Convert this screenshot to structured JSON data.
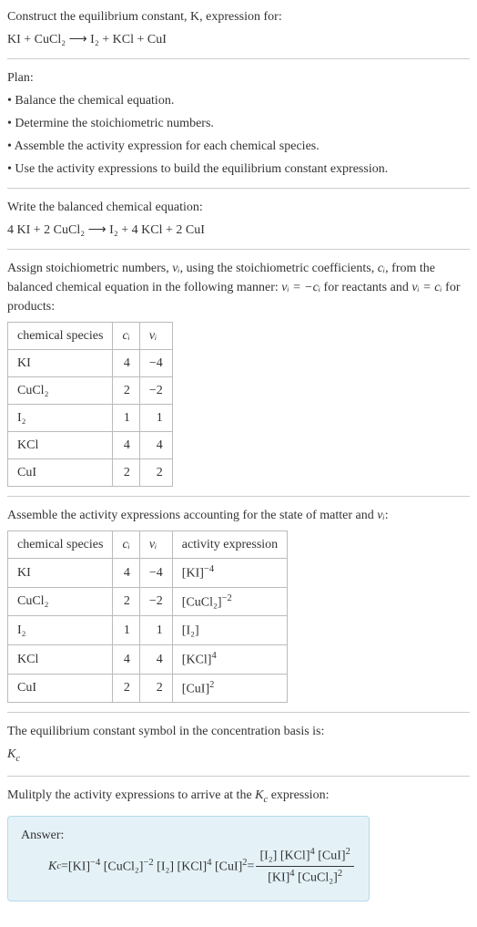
{
  "intro": {
    "header": "Construct the equilibrium constant, K, expression for:",
    "equation": "KI + CuCl₂ ⟶ I₂ + KCl + CuI"
  },
  "plan": {
    "title": "Plan:",
    "items": [
      "• Balance the chemical equation.",
      "• Determine the stoichiometric numbers.",
      "• Assemble the activity expression for each chemical species.",
      "• Use the activity expressions to build the equilibrium constant expression."
    ]
  },
  "balanced": {
    "label": "Write the balanced chemical equation:",
    "equation": "4 KI + 2 CuCl₂ ⟶ I₂ + 4 KCl + 2 CuI"
  },
  "assign": {
    "text_a": "Assign stoichiometric numbers, ",
    "nu": "νᵢ",
    "text_b": ", using the stoichiometric coefficients, ",
    "ci": "cᵢ",
    "text_c": ", from the balanced chemical equation in the following manner: ",
    "rel1": "νᵢ = −cᵢ",
    "text_d": " for reactants and ",
    "rel2": "νᵢ = cᵢ",
    "text_e": " for products:"
  },
  "table1": {
    "headers": {
      "species": "chemical species",
      "ci": "cᵢ",
      "nu": "νᵢ"
    },
    "rows": [
      {
        "species": "KI",
        "ci": "4",
        "nu": "−4"
      },
      {
        "species": "CuCl₂",
        "ci": "2",
        "nu": "−2"
      },
      {
        "species": "I₂",
        "ci": "1",
        "nu": "1"
      },
      {
        "species": "KCl",
        "ci": "4",
        "nu": "4"
      },
      {
        "species": "CuI",
        "ci": "2",
        "nu": "2"
      }
    ]
  },
  "assemble": {
    "text_a": "Assemble the activity expressions accounting for the state of matter and ",
    "nu": "νᵢ",
    "text_b": ":"
  },
  "table2": {
    "headers": {
      "species": "chemical species",
      "ci": "cᵢ",
      "nu": "νᵢ",
      "act": "activity expression"
    },
    "rows": [
      {
        "species": "KI",
        "ci": "4",
        "nu": "−4",
        "base": "[KI]",
        "exp": "−4"
      },
      {
        "species": "CuCl₂",
        "ci": "2",
        "nu": "−2",
        "base": "[CuCl₂]",
        "exp": "−2"
      },
      {
        "species": "I₂",
        "ci": "1",
        "nu": "1",
        "base": "[I₂]",
        "exp": ""
      },
      {
        "species": "KCl",
        "ci": "4",
        "nu": "4",
        "base": "[KCl]",
        "exp": "4"
      },
      {
        "species": "CuI",
        "ci": "2",
        "nu": "2",
        "base": "[CuI]",
        "exp": "2"
      }
    ]
  },
  "kc_symbol": {
    "line": "The equilibrium constant symbol in the concentration basis is:",
    "sym": "K",
    "sub": "c"
  },
  "multiply": {
    "text_a": "Mulitply the activity expressions to arrive at the ",
    "k": "K",
    "c": "c",
    "text_b": " expression:"
  },
  "answer": {
    "label": "Answer:",
    "k": "K",
    "c": "c",
    "eq": " = ",
    "terms": [
      {
        "base": "[KI]",
        "exp": "−4"
      },
      {
        "base": "[CuCl₂]",
        "exp": "−2"
      },
      {
        "base": "[I₂]",
        "exp": ""
      },
      {
        "base": "[KCl]",
        "exp": "4"
      },
      {
        "base": "[CuI]",
        "exp": "2"
      }
    ],
    "eq2": " = ",
    "num": [
      {
        "base": "[I₂]",
        "exp": ""
      },
      {
        "base": "[KCl]",
        "exp": "4"
      },
      {
        "base": "[CuI]",
        "exp": "2"
      }
    ],
    "den": [
      {
        "base": "[KI]",
        "exp": "4"
      },
      {
        "base": "[CuCl₂]",
        "exp": "2"
      }
    ]
  }
}
